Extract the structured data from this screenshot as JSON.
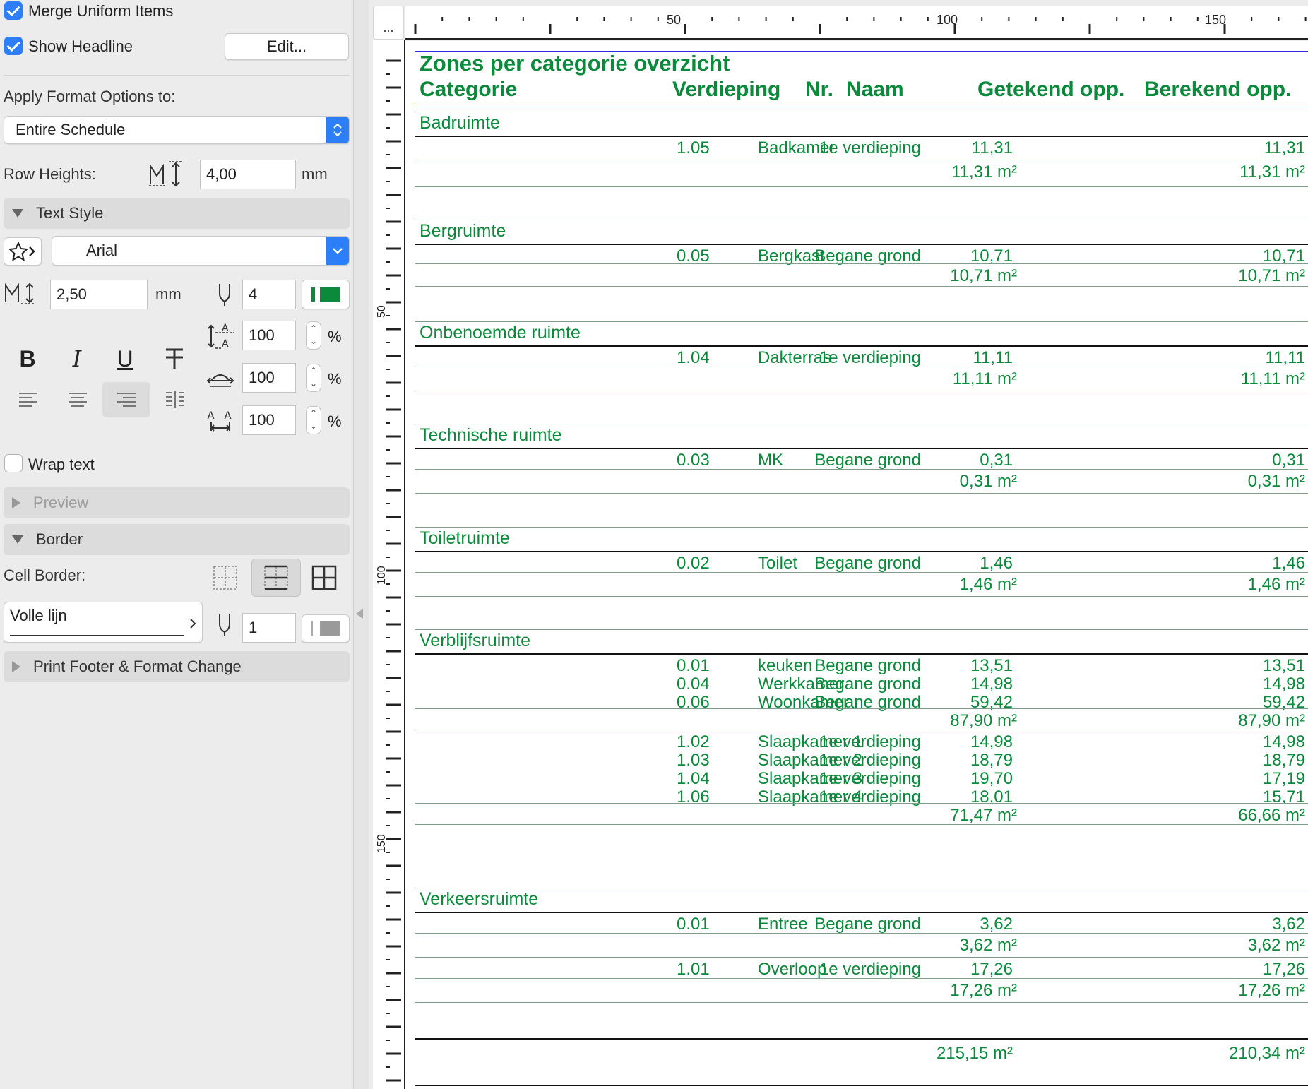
{
  "format_options": {
    "merge_uniform_items": {
      "label": "Merge Uniform Items",
      "checked": true
    },
    "show_headline": {
      "label": "Show Headline",
      "checked": true
    },
    "edit_button": "Edit...",
    "apply_label": "Apply Format Options to:",
    "apply_value": "Entire Schedule",
    "row_heights_label": "Row Heights:",
    "row_heights_value": "4,00",
    "row_heights_unit": "mm"
  },
  "text_style": {
    "section_label": "Text Style",
    "font": "Arial",
    "size_value": "2,50",
    "size_unit": "mm",
    "pen_value": "4",
    "pen_color": "#0a8a3a",
    "line_spacing": "100",
    "width_factor": "100",
    "char_spacing": "100",
    "percent": "%",
    "wrap_text_label": "Wrap text",
    "wrap_text_checked": false,
    "icons": {
      "bold": "B",
      "italic": "I",
      "underline": "U",
      "strike": "T"
    }
  },
  "preview": {
    "section_label": "Preview"
  },
  "border": {
    "section_label": "Border",
    "cell_border_label": "Cell Border:",
    "line_type": "Volle lijn",
    "pen_value": "1"
  },
  "print_footer": {
    "section_label": "Print Footer & Format Change"
  },
  "ruler": {
    "corner_label": "...",
    "h_labels": [
      "50",
      "100",
      "150"
    ],
    "v_labels": [
      "50",
      "100",
      "150"
    ]
  },
  "schedule": {
    "title": "Zones per categorie overzicht",
    "headers": {
      "categorie": "Categorie",
      "verdieping": "Verdieping",
      "nr": "Nr.",
      "naam": "Naam",
      "getekend": "Getekend opp.",
      "berekend": "Berekend opp."
    },
    "color": "#0a8a3a",
    "groups": [
      {
        "name": "Badruimte",
        "rows": [
          {
            "verdieping": "1e verdieping",
            "nr": "1.05",
            "naam": "Badkamer",
            "getekend": "11,31",
            "berekend": "11,31"
          },
          {
            "subtotal": true,
            "getekend": "11,31 m²",
            "berekend": "11,31 m²"
          }
        ]
      },
      {
        "name": "Bergruimte",
        "rows": [
          {
            "verdieping": "Begane grond",
            "nr": "0.05",
            "naam": "Bergkast",
            "getekend": "10,71",
            "berekend": "10,71"
          },
          {
            "subtotal": true,
            "getekend": "10,71 m²",
            "berekend": "10,71 m²"
          }
        ]
      },
      {
        "name": "Onbenoemde ruimte",
        "rows": [
          {
            "verdieping": "1e verdieping",
            "nr": "1.04",
            "naam": "Dakterras",
            "getekend": "11,11",
            "berekend": "11,11"
          },
          {
            "subtotal": true,
            "getekend": "11,11 m²",
            "berekend": "11,11 m²"
          }
        ]
      },
      {
        "name": "Technische ruimte",
        "rows": [
          {
            "verdieping": "Begane grond",
            "nr": "0.03",
            "naam": "MK",
            "getekend": "0,31",
            "berekend": "0,31"
          },
          {
            "subtotal": true,
            "getekend": "0,31 m²",
            "berekend": "0,31 m²"
          }
        ]
      },
      {
        "name": "Toiletruimte",
        "rows": [
          {
            "verdieping": "Begane grond",
            "nr": "0.02",
            "naam": "Toilet",
            "getekend": "1,46",
            "berekend": "1,46"
          },
          {
            "subtotal": true,
            "getekend": "1,46 m²",
            "berekend": "1,46 m²"
          }
        ]
      },
      {
        "name": "Verblijfsruimte",
        "rows": [
          {
            "verdieping": "Begane grond",
            "nr": "0.01",
            "naam": "keuken",
            "getekend": "13,51",
            "berekend": "13,51"
          },
          {
            "verdieping": "Begane grond",
            "nr": "0.04",
            "naam": "Werkkamer",
            "getekend": "14,98",
            "berekend": "14,98"
          },
          {
            "verdieping": "Begane grond",
            "nr": "0.06",
            "naam": "Woonkamer",
            "getekend": "59,42",
            "berekend": "59,42"
          },
          {
            "subtotal": true,
            "getekend": "87,90 m²",
            "berekend": "87,90 m²"
          },
          {
            "verdieping": "1e verdieping",
            "nr": "1.02",
            "naam": "Slaapkamer 1",
            "getekend": "14,98",
            "berekend": "14,98"
          },
          {
            "verdieping": "1e verdieping",
            "nr": "1.03",
            "naam": "Slaapkamer 2",
            "getekend": "18,79",
            "berekend": "18,79"
          },
          {
            "verdieping": "1e verdieping",
            "nr": "1.04",
            "naam": "Slaapkamer 3",
            "getekend": "19,70",
            "berekend": "17,19"
          },
          {
            "verdieping": "1e verdieping",
            "nr": "1.06",
            "naam": "Slaapkamer 4",
            "getekend": "18,01",
            "berekend": "15,71"
          },
          {
            "subtotal": true,
            "getekend": "71,47 m²",
            "berekend": "66,66 m²"
          }
        ]
      },
      {
        "name": "Verkeersruimte",
        "rows": [
          {
            "verdieping": "Begane grond",
            "nr": "0.01",
            "naam": "Entree",
            "getekend": "3,62",
            "berekend": "3,62"
          },
          {
            "subtotal": true,
            "getekend": "3,62 m²",
            "berekend": "3,62 m²"
          },
          {
            "verdieping": "1e verdieping",
            "nr": "1.01",
            "naam": "Overloop",
            "getekend": "17,26",
            "berekend": "17,26"
          },
          {
            "subtotal": true,
            "getekend": "17,26 m²",
            "berekend": "17,26 m²"
          }
        ]
      }
    ],
    "grand_total": {
      "getekend": "215,15 m²",
      "berekend": "210,34 m²"
    }
  }
}
